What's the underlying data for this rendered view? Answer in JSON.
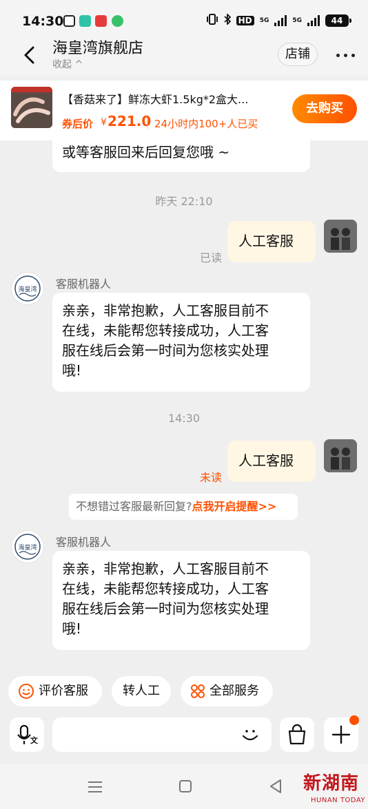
{
  "status_bar": {
    "time": "14:30",
    "network": [
      "HD",
      "5G",
      "5G"
    ],
    "battery": "44"
  },
  "header": {
    "shop_name": "海皇湾旗舰店",
    "collapse_label": "收起 ^",
    "store_button": "店铺"
  },
  "product": {
    "title": "【香菇来了】鲜冻大虾1.5kg*2盒大...",
    "price_label": "券后价",
    "currency": "¥",
    "price": "221.0",
    "sold_text": "24小时内100+人已买",
    "buy_button": "去购买"
  },
  "chat": {
    "partial_message": "或等客服回来后回复您哦 ~",
    "time_1": "昨天 22:10",
    "user_message_1": "人工客服",
    "read_status_1": "已读",
    "bot_name": "客服机器人",
    "bot_logo_text": "海皇湾",
    "bot_message_lines": [
      "亲亲，非常抱歉，人工客服目前不",
      "在线，未能帮您转接成功，人工客",
      "服在线后会第一时间为您核实处理",
      "哦!"
    ],
    "time_2": "14:30",
    "user_message_2": "人工客服",
    "read_status_2": "未读",
    "notice_text": "不想错过客服最新回复?",
    "notice_link": "点我开启提醒>>"
  },
  "quick_actions": {
    "rate": "评价客服",
    "transfer": "转人工",
    "all_services": "全部服务"
  },
  "input_bar": {
    "voice_label": "文"
  },
  "watermark": {
    "brand": "新湖南",
    "sub": "HUNAN TODAY"
  },
  "colors": {
    "accent": "#ff5000",
    "accent_light": "#ff8a00",
    "bubble_mine": "#fff7e4",
    "background": "#efefef"
  }
}
